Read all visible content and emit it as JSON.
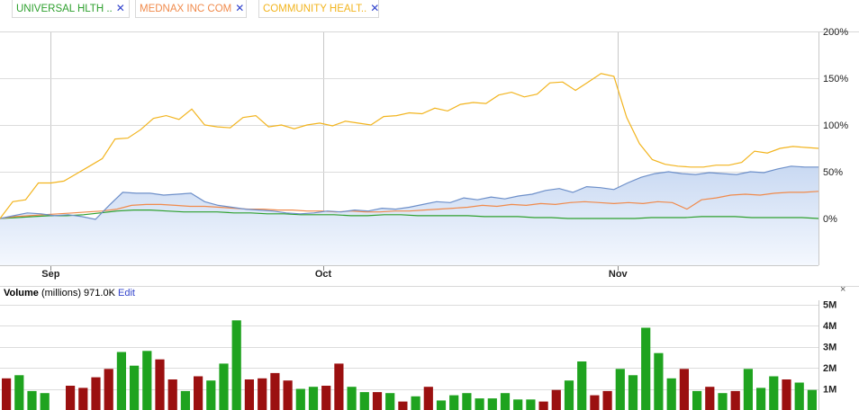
{
  "legend": [
    {
      "label": "UNIVERSAL HLTH ..",
      "color": "#2ea02e",
      "remove_icon": "close-icon"
    },
    {
      "label": "MEDNAX INC COM",
      "color": "#f08a4b",
      "remove_icon": "close-icon"
    },
    {
      "label": "COMMUNITY HEALT..",
      "color": "#f2b41e",
      "remove_icon": "close-icon"
    }
  ],
  "remove_glyph": "✕",
  "volume_panel": {
    "title": "Volume",
    "units": "(millions)",
    "value": "971.0K",
    "edit_label": "Edit",
    "close_glyph": "×"
  },
  "chart_data": [
    {
      "type": "line",
      "x_labels": [
        "Sep",
        "Oct",
        "Nov"
      ],
      "y_ticks": [
        "200%",
        "150%",
        "100%",
        "50%",
        "0%"
      ],
      "ylim": [
        -50,
        200
      ],
      "grid": true,
      "area_fill_color": "#dde8f8",
      "series": [
        {
          "name": "COMMUNITY HEALT..",
          "color": "#f2b41e",
          "values": [
            0,
            18,
            20,
            38,
            38,
            40,
            48,
            56,
            64,
            85,
            86,
            95,
            107,
            110,
            106,
            117,
            100,
            98,
            97,
            108,
            110,
            98,
            100,
            96,
            100,
            102,
            99,
            104,
            102,
            100,
            109,
            110,
            113,
            112,
            118,
            115,
            122,
            124,
            123,
            132,
            135,
            130,
            133,
            145,
            146,
            137,
            146,
            155,
            152,
            108,
            80,
            63,
            58,
            56,
            55,
            55,
            57,
            57,
            60,
            72,
            70,
            75,
            77,
            76,
            75
          ]
        },
        {
          "name": "",
          "color": "#6d8fc9",
          "values": [
            0,
            3,
            6,
            5,
            3,
            4,
            2,
            -1,
            14,
            28,
            27,
            27,
            25,
            26,
            27,
            18,
            14,
            12,
            10,
            9,
            8,
            6,
            5,
            6,
            8,
            7,
            9,
            8,
            11,
            10,
            12,
            15,
            18,
            17,
            22,
            20,
            23,
            21,
            24,
            26,
            30,
            32,
            28,
            34,
            33,
            31,
            38,
            44,
            48,
            50,
            48,
            47,
            49,
            48,
            47,
            50,
            49,
            53,
            56,
            55,
            55
          ]
        },
        {
          "name": "",
          "color": "#f08a4b",
          "values": [
            0,
            2,
            3,
            4,
            5,
            6,
            7,
            8,
            10,
            14,
            15,
            15,
            14,
            13,
            13,
            12,
            11,
            10,
            10,
            9,
            9,
            8,
            8,
            7,
            8,
            7,
            7,
            8,
            8,
            9,
            10,
            11,
            12,
            14,
            13,
            15,
            14,
            16,
            15,
            17,
            18,
            17,
            16,
            17,
            16,
            18,
            17,
            10,
            20,
            22,
            25,
            26,
            25,
            27,
            28,
            28,
            29
          ]
        },
        {
          "name": "",
          "color": "#2ea02e",
          "values": [
            0,
            1,
            2,
            3,
            3,
            4,
            6,
            8,
            9,
            9,
            8,
            7,
            7,
            7,
            6,
            6,
            5,
            5,
            4,
            4,
            4,
            3,
            3,
            4,
            4,
            3,
            3,
            3,
            3,
            2,
            2,
            2,
            1,
            1,
            0,
            0,
            0,
            0,
            0,
            1,
            1,
            1,
            2,
            2,
            2,
            1,
            1,
            1,
            1,
            0
          ]
        }
      ]
    },
    {
      "type": "bar",
      "title": "Volume",
      "units": "(millions)",
      "y_ticks": [
        "5M",
        "4M",
        "3M",
        "2M",
        "1M"
      ],
      "ylim": [
        0,
        5.2
      ],
      "up_color": "#1fa31f",
      "down_color": "#9b1010",
      "values": [
        1.5,
        1.65,
        0.9,
        0.8,
        0,
        1.15,
        1.05,
        1.55,
        1.95,
        2.75,
        2.1,
        2.8,
        2.4,
        1.45,
        0.9,
        1.6,
        1.4,
        2.2,
        4.25,
        1.45,
        1.5,
        1.75,
        1.4,
        1.0,
        1.1,
        1.15,
        2.2,
        1.1,
        0.85,
        0.85,
        0.8,
        0.4,
        0.65,
        1.1,
        0.45,
        0.7,
        0.8,
        0.55,
        0.55,
        0.8,
        0.5,
        0.5,
        0.4,
        0.95,
        1.4,
        2.3,
        0.7,
        0.9,
        1.95,
        1.65,
        3.9,
        2.7,
        1.5,
        1.95,
        0.9,
        1.1,
        0.8,
        0.9,
        1.95,
        1.05,
        1.6,
        1.45,
        1.3,
        0.95
      ],
      "direction": [
        "down",
        "up",
        "up",
        "up",
        "none",
        "down",
        "down",
        "down",
        "down",
        "up",
        "up",
        "up",
        "down",
        "down",
        "up",
        "down",
        "up",
        "up",
        "up",
        "down",
        "down",
        "down",
        "down",
        "up",
        "up",
        "down",
        "down",
        "up",
        "up",
        "down",
        "up",
        "down",
        "up",
        "down",
        "up",
        "up",
        "up",
        "up",
        "up",
        "up",
        "up",
        "up",
        "down",
        "down",
        "up",
        "up",
        "down",
        "down",
        "up",
        "up",
        "up",
        "up",
        "up",
        "down",
        "up",
        "down",
        "up",
        "down",
        "up",
        "up",
        "up",
        "down",
        "up",
        "up"
      ]
    }
  ]
}
